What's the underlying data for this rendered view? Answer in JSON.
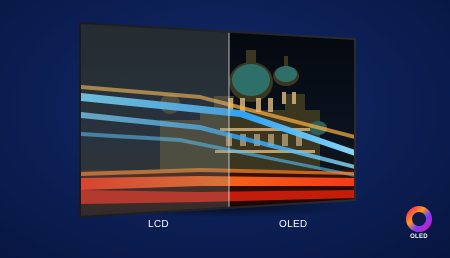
{
  "comparison": {
    "left_label": "LCD",
    "right_label": "OLED"
  },
  "badge": {
    "text": "OLED",
    "icon": "oled-ring-icon"
  },
  "colors": {
    "background_center": "#17306e",
    "background_edge": "#071540",
    "light_trail_blue": "#39b8ff",
    "light_trail_red": "#ff3b1a"
  }
}
